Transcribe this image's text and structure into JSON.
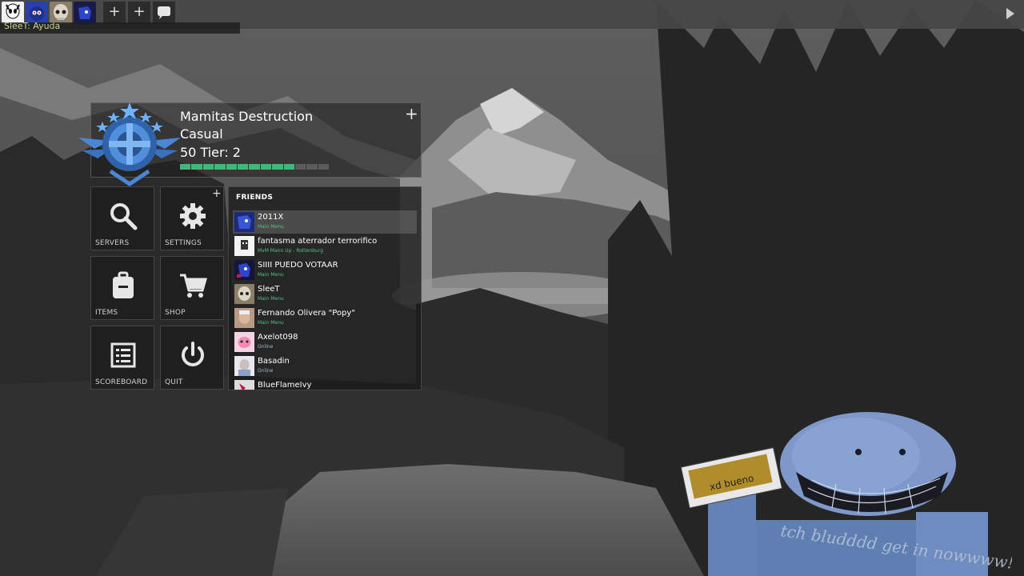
{
  "topbar": {
    "chat_line": "SleeT: Ayuda",
    "avatar_icons": [
      "hollow-knight-avatar",
      "sonic-exe-avatar",
      "skull-avatar",
      "sonic-avatar"
    ],
    "plus_label_1": "+",
    "plus_label_2": "+"
  },
  "player": {
    "name": "Mamitas Destruction",
    "mode": "Casual",
    "tier": "50 Tier: 2",
    "xp_progress": 0.77,
    "accent_color": "#3fb979"
  },
  "menu": {
    "servers": "SERVERS",
    "settings": "SETTINGS",
    "items": "ITEMS",
    "shop": "SHOP",
    "scoreboard": "SCOREBOARD",
    "quit": "QUIT"
  },
  "friends": {
    "title": "FRIENDS",
    "list": [
      {
        "name": "2011X",
        "status": "Main Menu"
      },
      {
        "name": "fantasma aterrador terrorifico",
        "status": "MvM Mann Up - Rottenburg"
      },
      {
        "name": "SIIII PUEDO VOTAAR",
        "status": "Main Menu"
      },
      {
        "name": "SleeT",
        "status": "Main Menu"
      },
      {
        "name": "Fernando Olivera \"Popy\"",
        "status": "Main Menu"
      },
      {
        "name": "Axelot098",
        "status": "Online"
      },
      {
        "name": "Basadin",
        "status": "Online"
      },
      {
        "name": "BlueFlameIvy",
        "status": ""
      }
    ]
  },
  "wallpaper": {
    "note_text": "xd bueno",
    "scribble": "tch bludddd get in nowwww!!"
  }
}
